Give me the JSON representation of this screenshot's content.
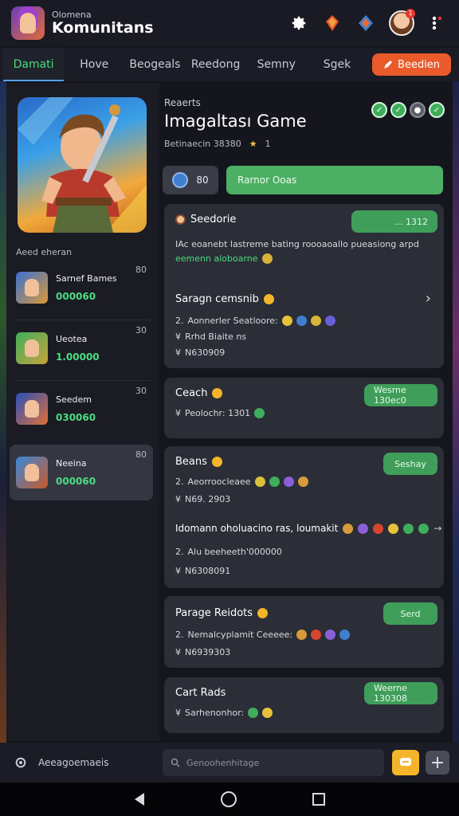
{
  "header": {
    "subtitle": "Olomena",
    "title": "Komunitans",
    "icons": [
      "gear-icon",
      "fire-crystal-icon",
      "gem-icon",
      "profile-avatar",
      "more-icon"
    ],
    "notif_count": "1"
  },
  "tabs": [
    {
      "label": "Damati",
      "active": true
    },
    {
      "label": "Hove"
    },
    {
      "label": "Beogeals"
    },
    {
      "label": "Reedong"
    },
    {
      "label": "Semny"
    },
    {
      "label": "Sgek"
    }
  ],
  "tab_action": "Beedien",
  "sidebar": {
    "section_label": "Aeed eheran",
    "items": [
      {
        "name": "Sarnef Bames",
        "score": "000060",
        "num": "80"
      },
      {
        "name": "Ueotea",
        "score": "1.00000",
        "num": "30"
      },
      {
        "name": "Seedem",
        "score": "030060",
        "num": "30"
      },
      {
        "name": "Neeina",
        "score": "000060",
        "num": "80",
        "selected": true
      }
    ]
  },
  "main": {
    "subtitle": "Reaerts",
    "title": "Imagaltası Game",
    "meta_text": "Betinaecin 38380",
    "meta_count": "1",
    "follow_count": "80",
    "join_label": "Rarnor Ooas",
    "cards": [
      {
        "title": "Seedorie",
        "pill": "... 1312",
        "desc": "IAc eoanebt lastreme bating roooaoallo pueasiong arpd",
        "desc_green": "eemenn aloboarne",
        "sub_title": "Saragn cemsnib",
        "line1": "Aonnerler Seatloore:",
        "line2": "Rrhd Biaite ns",
        "line3": "N630909"
      },
      {
        "title": "Ceach",
        "pill": "Wesrne 130ec0",
        "line1": "Peolochr: 1301"
      },
      {
        "title": "Beans",
        "pill": "Seshay",
        "line1": "Aeorroocleaee",
        "line2": "N69. 2903",
        "sub_title": "Idomann oholuacino ras, loumakit",
        "line3": "Alu beeheeth'000000",
        "line4": "N6308091"
      },
      {
        "title": "Parage Reidots",
        "pill": "Serd",
        "line1": "Nemalcyplamit Ceeeee:",
        "line2": "N6939303"
      },
      {
        "title": "Cart Rads",
        "pill": "Weerne 130308",
        "line1": "Sarhenonhor:"
      }
    ]
  },
  "bottom": {
    "left_label": "Aeeagoemaeis",
    "search_placeholder": "Genoohenhitage"
  },
  "colors": {
    "accent_green": "#4ade80",
    "button_green": "#4caf63",
    "orange": "#ea5a2a",
    "yellow": "#f5b52a"
  }
}
